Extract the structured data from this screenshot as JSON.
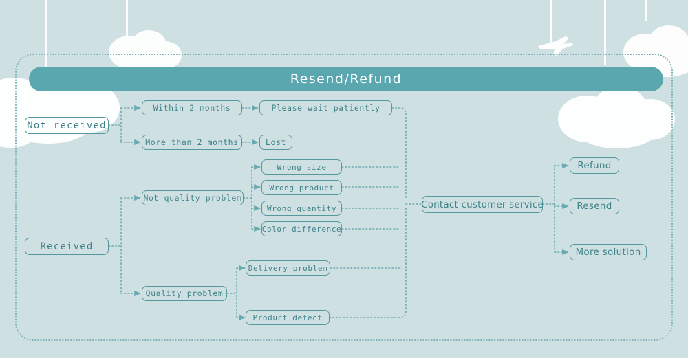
{
  "banner": {
    "title": "Resend/Refund"
  },
  "nodes": {
    "not_received": "Not received",
    "received": "Received",
    "within_2_months": "Within 2 months",
    "more_than_2_months": "More than 2 months",
    "please_wait": "Please wait patiently",
    "lost": "Lost",
    "not_quality_problem": "Not quality problem",
    "quality_problem": "Quality problem",
    "wrong_size": "Wrong size",
    "wrong_product": "Wrong product",
    "wrong_quantity": "Wrong quantity",
    "color_difference": "Color difference",
    "delivery_problem": "Delivery problem",
    "product_defect": "Product defect",
    "contact_customer_service": "Contact customer service",
    "refund": "Refund",
    "resend": "Resend",
    "more_solution": "More solution"
  },
  "colors": {
    "background": "#cfe0e2",
    "banner": "#5aa7b0",
    "node_border": "#55999f",
    "node_text": "#3f8289",
    "connector": "#6aa9af",
    "banner_text": "#ffffff",
    "decoration": "#ffffff"
  },
  "chart_data": {
    "type": "diagram",
    "title": "Resend/Refund",
    "flow": [
      {
        "from": "Not received",
        "to": "Within 2 months"
      },
      {
        "from": "Not received",
        "to": "More than 2 months"
      },
      {
        "from": "Within 2 months",
        "to": "Please wait patiently"
      },
      {
        "from": "More than 2 months",
        "to": "Lost"
      },
      {
        "from": "Received",
        "to": "Not quality problem"
      },
      {
        "from": "Received",
        "to": "Quality problem"
      },
      {
        "from": "Not quality problem",
        "to": "Wrong size"
      },
      {
        "from": "Not quality problem",
        "to": "Wrong product"
      },
      {
        "from": "Not quality problem",
        "to": "Wrong quantity"
      },
      {
        "from": "Not quality problem",
        "to": "Color difference"
      },
      {
        "from": "Quality problem",
        "to": "Delivery problem"
      },
      {
        "from": "Quality problem",
        "to": "Product defect"
      },
      {
        "from": "Please wait patiently",
        "to": "Contact customer service"
      },
      {
        "from": "Wrong size",
        "to": "Contact customer service"
      },
      {
        "from": "Wrong product",
        "to": "Contact customer service"
      },
      {
        "from": "Wrong quantity",
        "to": "Contact customer service"
      },
      {
        "from": "Color difference",
        "to": "Contact customer service"
      },
      {
        "from": "Delivery problem",
        "to": "Contact customer service"
      },
      {
        "from": "Product defect",
        "to": "Contact customer service"
      },
      {
        "from": "Contact customer service",
        "to": "Refund"
      },
      {
        "from": "Contact customer service",
        "to": "Resend"
      },
      {
        "from": "Contact customer service",
        "to": "More solution"
      }
    ]
  },
  "decorations": {
    "cloud_count": 5,
    "plane_count": 1,
    "string_count": 5
  }
}
